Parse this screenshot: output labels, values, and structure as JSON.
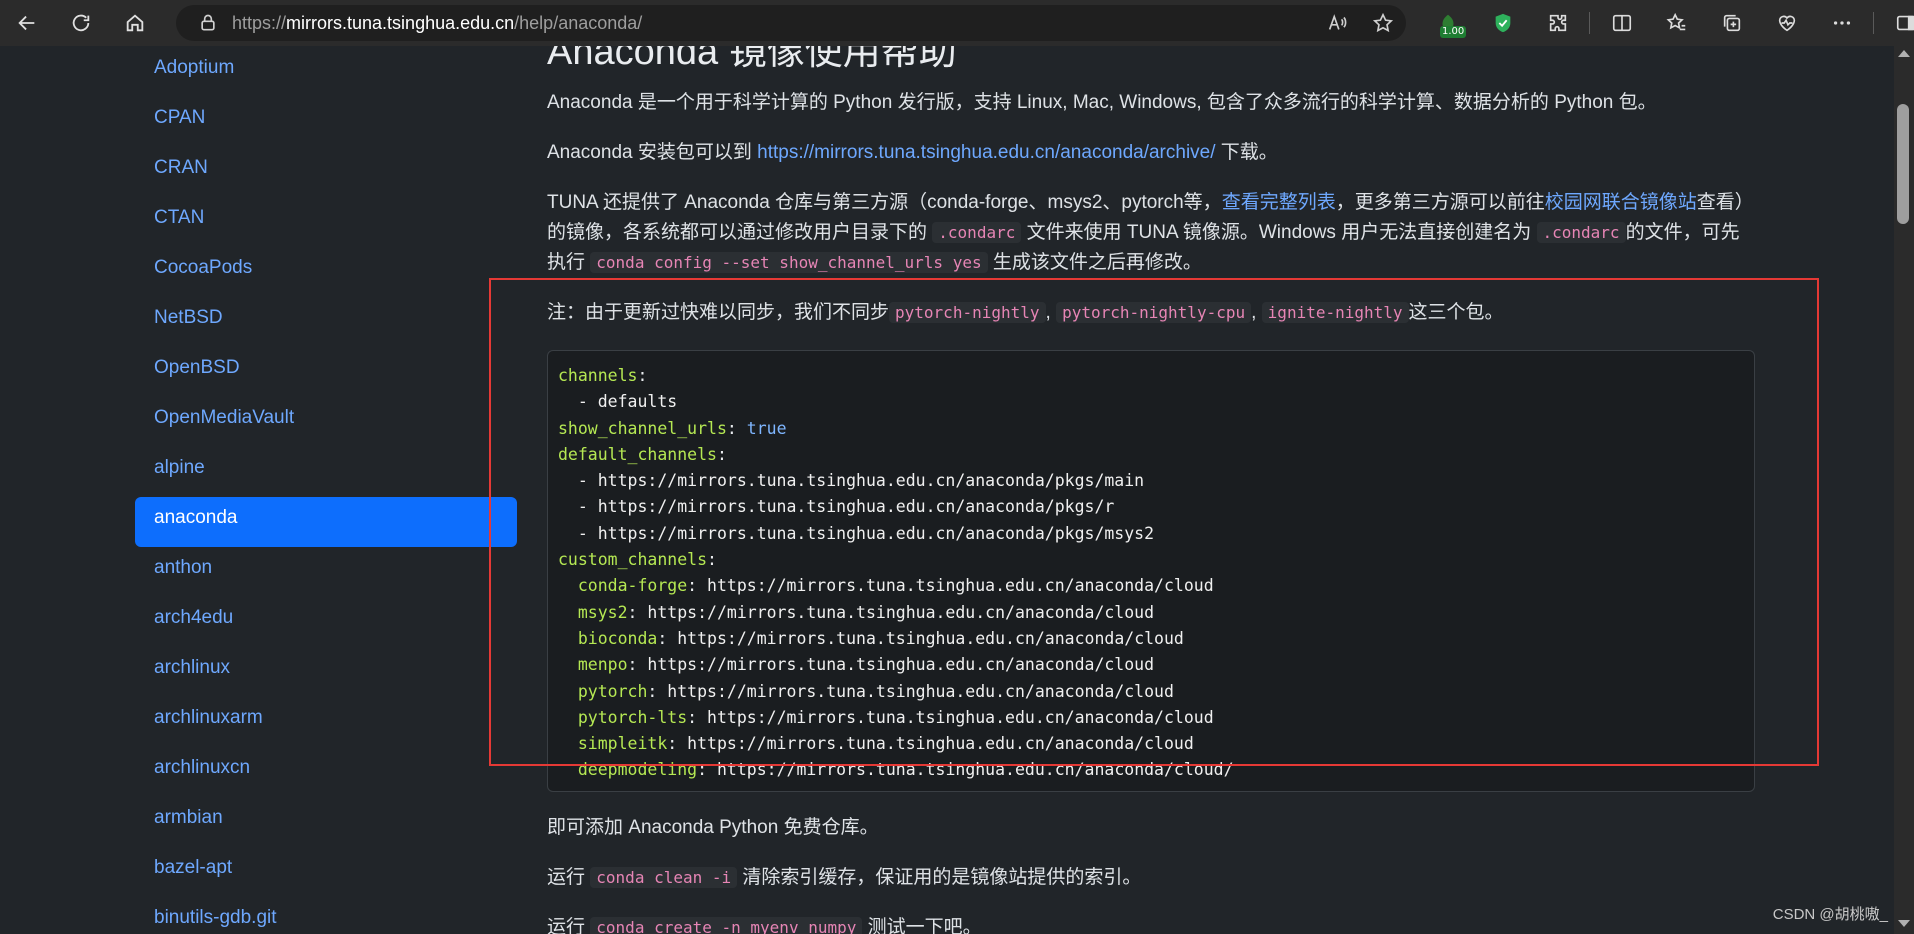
{
  "browser": {
    "url_prefix": "https://",
    "url_host": "mirrors.tuna.tsinghua.edu.cn",
    "url_path": "/help/anaconda/",
    "extension_badge": "1.00"
  },
  "sidebar": {
    "items": [
      {
        "label": "Adoptium"
      },
      {
        "label": "CPAN"
      },
      {
        "label": "CRAN"
      },
      {
        "label": "CTAN"
      },
      {
        "label": "CocoaPods"
      },
      {
        "label": "NetBSD"
      },
      {
        "label": "OpenBSD"
      },
      {
        "label": "OpenMediaVault"
      },
      {
        "label": "alpine"
      },
      {
        "label": "anaconda",
        "active": true
      },
      {
        "label": "anthon"
      },
      {
        "label": "arch4edu"
      },
      {
        "label": "archlinux"
      },
      {
        "label": "archlinuxarm"
      },
      {
        "label": "archlinuxcn"
      },
      {
        "label": "armbian"
      },
      {
        "label": "bazel-apt"
      },
      {
        "label": "binutils-gdb.git"
      }
    ]
  },
  "content": {
    "title": "Anaconda 镜像使用帮助",
    "intro": "Anaconda 是一个用于科学计算的 Python 发行版，支持 Linux, Mac, Windows, 包含了众多流行的科学计算、数据分析的 Python 包。",
    "install_prefix": "Anaconda 安装包可以到 ",
    "install_link": "https://mirrors.tuna.tsinghua.edu.cn/anaconda/archive/",
    "install_suffix": " 下载。",
    "tuna_1": "TUNA 还提供了 Anaconda 仓库与第三方源（conda-forge、msys2、pytorch等，",
    "tuna_link1": "查看完整列表",
    "tuna_2": "，更多第三方源可以前往",
    "tuna_link2": "校园网联合镜像站",
    "tuna_3": "查看）的镜像，各系统都可以通过修改用户目录下的 ",
    "tuna_code1": ".condarc",
    "tuna_4": " 文件来使用 TUNA 镜像源。Windows 用户无法直接创建名为 ",
    "tuna_code2": ".condarc",
    "tuna_5": "的文件，可先执行 ",
    "tuna_code3": "conda config --set show_channel_urls yes",
    "tuna_6": " 生成该文件之后再修改。",
    "note_1": "注：由于更新过快难以同步，我们不同步",
    "note_code1": "pytorch-nightly",
    "note_sep1": ", ",
    "note_code2": "pytorch-nightly-cpu",
    "note_sep2": ", ",
    "note_code3": "ignite-nightly",
    "note_2": "这三个包。",
    "code": {
      "channels": "channels",
      "defaults": "defaults",
      "show_key": "show_channel_urls",
      "show_val": "true",
      "default_channels": "default_channels",
      "dc1": "https://mirrors.tuna.tsinghua.edu.cn/anaconda/pkgs/main",
      "dc2": "https://mirrors.tuna.tsinghua.edu.cn/anaconda/pkgs/r",
      "dc3": "https://mirrors.tuna.tsinghua.edu.cn/anaconda/pkgs/msys2",
      "custom_channels": "custom_channels",
      "cc": [
        {
          "key": "conda-forge",
          "val": "https://mirrors.tuna.tsinghua.edu.cn/anaconda/cloud"
        },
        {
          "key": "msys2",
          "val": "https://mirrors.tuna.tsinghua.edu.cn/anaconda/cloud"
        },
        {
          "key": "bioconda",
          "val": "https://mirrors.tuna.tsinghua.edu.cn/anaconda/cloud"
        },
        {
          "key": "menpo",
          "val": "https://mirrors.tuna.tsinghua.edu.cn/anaconda/cloud"
        },
        {
          "key": "pytorch",
          "val": "https://mirrors.tuna.tsinghua.edu.cn/anaconda/cloud"
        },
        {
          "key": "pytorch-lts",
          "val": "https://mirrors.tuna.tsinghua.edu.cn/anaconda/cloud"
        },
        {
          "key": "simpleitk",
          "val": "https://mirrors.tuna.tsinghua.edu.cn/anaconda/cloud"
        },
        {
          "key": "deepmodeling",
          "val": "https://mirrors.tuna.tsinghua.edu.cn/anaconda/cloud/"
        }
      ]
    },
    "after_code": "即可添加 Anaconda Python 免费仓库。",
    "run1_prefix": "运行 ",
    "run1_code": "conda clean -i",
    "run1_suffix": " 清除索引缓存，保证用的是镜像站提供的索引。",
    "run2_prefix": "运行 ",
    "run2_code": "conda create -n myenv numpy",
    "run2_suffix": " 测试一下吧。"
  },
  "watermark": "CSDN @胡桃嗷_",
  "colors": {
    "accent": "#0d6efd",
    "link": "#6ea8fe",
    "highlight_box": "#e53935"
  }
}
